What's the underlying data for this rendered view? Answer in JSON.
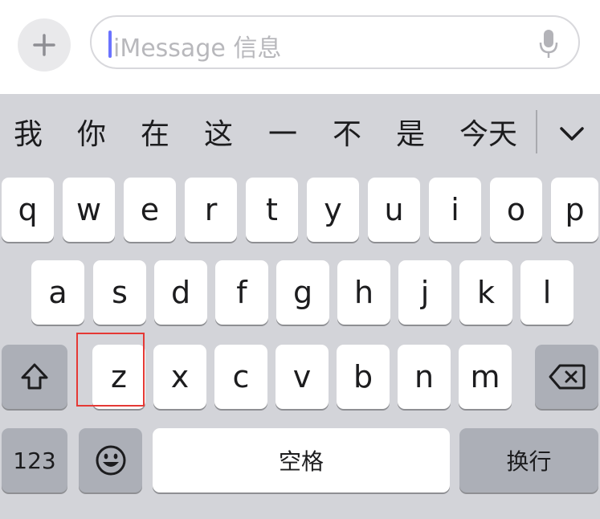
{
  "message_bar": {
    "placeholder": "iMessage 信息"
  },
  "candidates": [
    "我",
    "你",
    "在",
    "这",
    "一",
    "不",
    "是",
    "今天"
  ],
  "keyboard": {
    "row1": [
      "q",
      "w",
      "e",
      "r",
      "t",
      "y",
      "u",
      "i",
      "o",
      "p"
    ],
    "row2": [
      "a",
      "s",
      "d",
      "f",
      "g",
      "h",
      "j",
      "k",
      "l"
    ],
    "row3": [
      "z",
      "x",
      "c",
      "v",
      "b",
      "n",
      "m"
    ],
    "numbers_label": "123",
    "space_label": "空格",
    "return_label": "换行"
  },
  "colors": {
    "keyboard_bg": "#d3d4d9",
    "key_bg": "#ffffff",
    "function_key_bg": "#acafb7",
    "cursor": "#6b73ff",
    "highlight_box": "#e53935"
  },
  "icons": {
    "plus": "plus-icon",
    "mic": "microphone-icon",
    "expand": "chevron-down-icon",
    "shift": "shift-arrow-icon",
    "delete": "backspace-icon",
    "emoji": "smiley-icon"
  }
}
